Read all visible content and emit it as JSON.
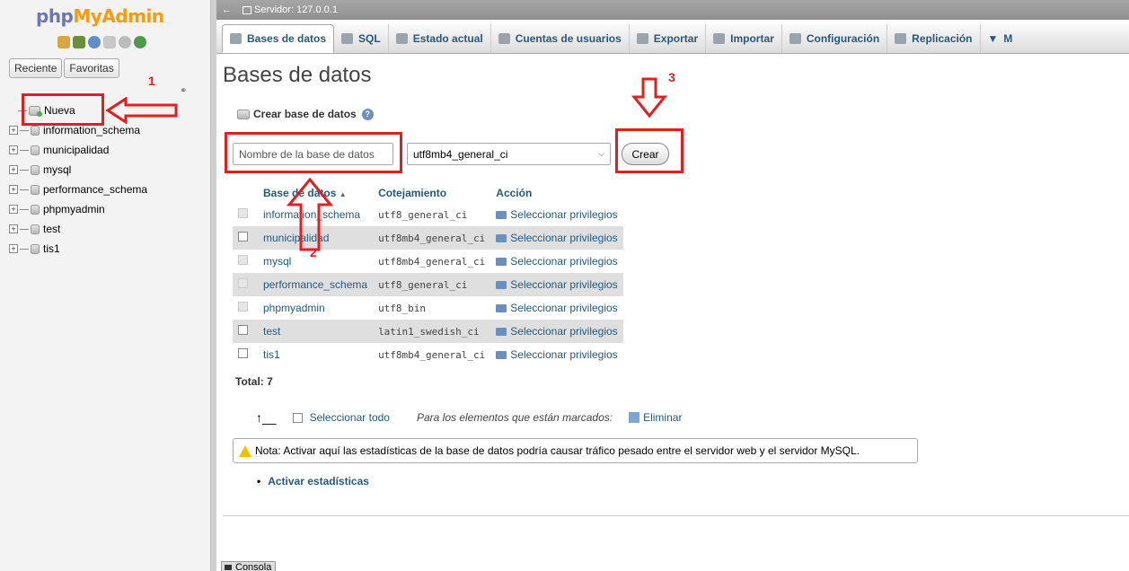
{
  "nav": {
    "logo_part1": "php",
    "logo_part2": "MyAdmin",
    "tabs": [
      "Reciente",
      "Favoritas"
    ],
    "new_label": "Nueva",
    "databases": [
      "information_schema",
      "municipalidad",
      "mysql",
      "performance_schema",
      "phpmyadmin",
      "test",
      "tis1"
    ]
  },
  "server_bar": {
    "label": "Servidor: 127.0.0.1"
  },
  "menu": {
    "tabs": [
      "Bases de datos",
      "SQL",
      "Estado actual",
      "Cuentas de usuarios",
      "Exportar",
      "Importar",
      "Configuración",
      "Replicación",
      "Más"
    ],
    "more_visible": "M"
  },
  "main": {
    "title": "Bases de datos",
    "create_heading": "Crear base de datos",
    "db_name_placeholder": "Nombre de la base de datos",
    "collation_selected": "utf8mb4_general_ci",
    "create_button": "Crear",
    "table": {
      "headers": {
        "name": "Base de datos",
        "collation": "Cotejamiento",
        "action": "Acción"
      },
      "rows": [
        {
          "name": "information_schema",
          "collation": "utf8_general_ci",
          "action": "Seleccionar privilegios"
        },
        {
          "name": "municipalidad",
          "collation": "utf8mb4_general_ci",
          "action": "Seleccionar privilegios"
        },
        {
          "name": "mysql",
          "collation": "utf8mb4_general_ci",
          "action": "Seleccionar privilegios"
        },
        {
          "name": "performance_schema",
          "collation": "utf8_general_ci",
          "action": "Seleccionar privilegios"
        },
        {
          "name": "phpmyadmin",
          "collation": "utf8_bin",
          "action": "Seleccionar privilegios"
        },
        {
          "name": "test",
          "collation": "latin1_swedish_ci",
          "action": "Seleccionar privilegios"
        },
        {
          "name": "tis1",
          "collation": "utf8mb4_general_ci",
          "action": "Seleccionar privilegios"
        }
      ]
    },
    "total": "Total: 7",
    "select_all": "Seleccionar todo",
    "marked_label": "Para los elementos que están marcados:",
    "delete_label": "Eliminar",
    "notice": "Nota: Activar aquí las estadísticas de la base de datos podría causar tráfico pesado entre el servidor web y el servidor MySQL.",
    "stats_link": "Activar estadísticas",
    "console": "Consola"
  },
  "annotations": {
    "step1": "1",
    "step2": "2",
    "step3": "3",
    "color": "#e02020"
  }
}
